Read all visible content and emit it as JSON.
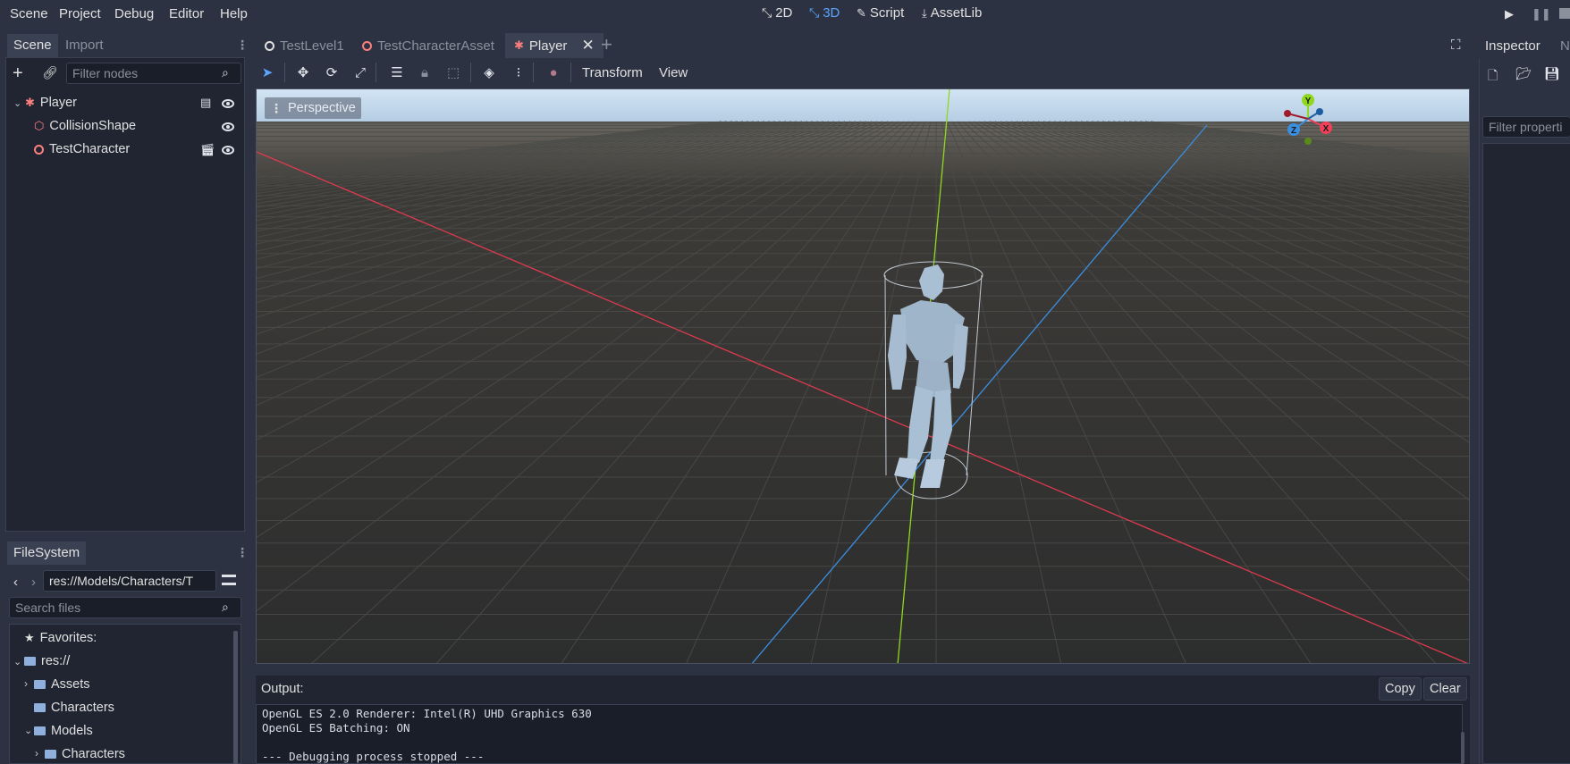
{
  "menu": [
    "Scene",
    "Project",
    "Debug",
    "Editor",
    "Help"
  ],
  "workspaces": [
    {
      "label": "2D",
      "active": false
    },
    {
      "label": "3D",
      "active": true
    },
    {
      "label": "Script",
      "active": false
    },
    {
      "label": "AssetLib",
      "active": false
    }
  ],
  "scene_dock": {
    "tabs": [
      "Scene",
      "Import"
    ],
    "filter_placeholder": "Filter nodes",
    "nodes": [
      {
        "label": "Player",
        "icon": "player-node-icon"
      },
      {
        "label": "CollisionShape",
        "icon": "collision-shape-icon"
      },
      {
        "label": "TestCharacter",
        "icon": "spatial-node-icon"
      }
    ]
  },
  "filesystem": {
    "tab": "FileSystem",
    "path": "res://Models/Characters/T",
    "search_placeholder": "Search files",
    "items": [
      {
        "label": "Favorites:",
        "icon": "star-icon"
      },
      {
        "label": "res://",
        "icon": "folder-icon"
      },
      {
        "label": "Assets",
        "icon": "folder-icon"
      },
      {
        "label": "Characters",
        "icon": "folder-icon"
      },
      {
        "label": "Models",
        "icon": "folder-icon"
      },
      {
        "label": "Characters",
        "icon": "folder-icon"
      }
    ]
  },
  "editor_tabs": [
    {
      "label": "TestLevel1",
      "active": false
    },
    {
      "label": "TestCharacterAsset",
      "active": false
    },
    {
      "label": "Player",
      "active": true
    }
  ],
  "toolbar": {
    "transform_label": "Transform",
    "view_label": "View"
  },
  "viewport": {
    "perspective_label": "Perspective",
    "gizmo_axes": [
      "Y",
      "X",
      "Z"
    ],
    "colors": {
      "x_axis": "#f0405a",
      "y_axis": "#8fd81f",
      "z_axis": "#3b8fe0"
    }
  },
  "output": {
    "title": "Output:",
    "copy_label": "Copy",
    "clear_label": "Clear",
    "lines": [
      "OpenGL ES 2.0 Renderer: Intel(R) UHD Graphics 630",
      "OpenGL ES Batching: ON",
      "",
      "--- Debugging process stopped ---"
    ]
  },
  "inspector": {
    "tabs": [
      "Inspector",
      "N"
    ],
    "filter_placeholder": "Filter properti"
  }
}
